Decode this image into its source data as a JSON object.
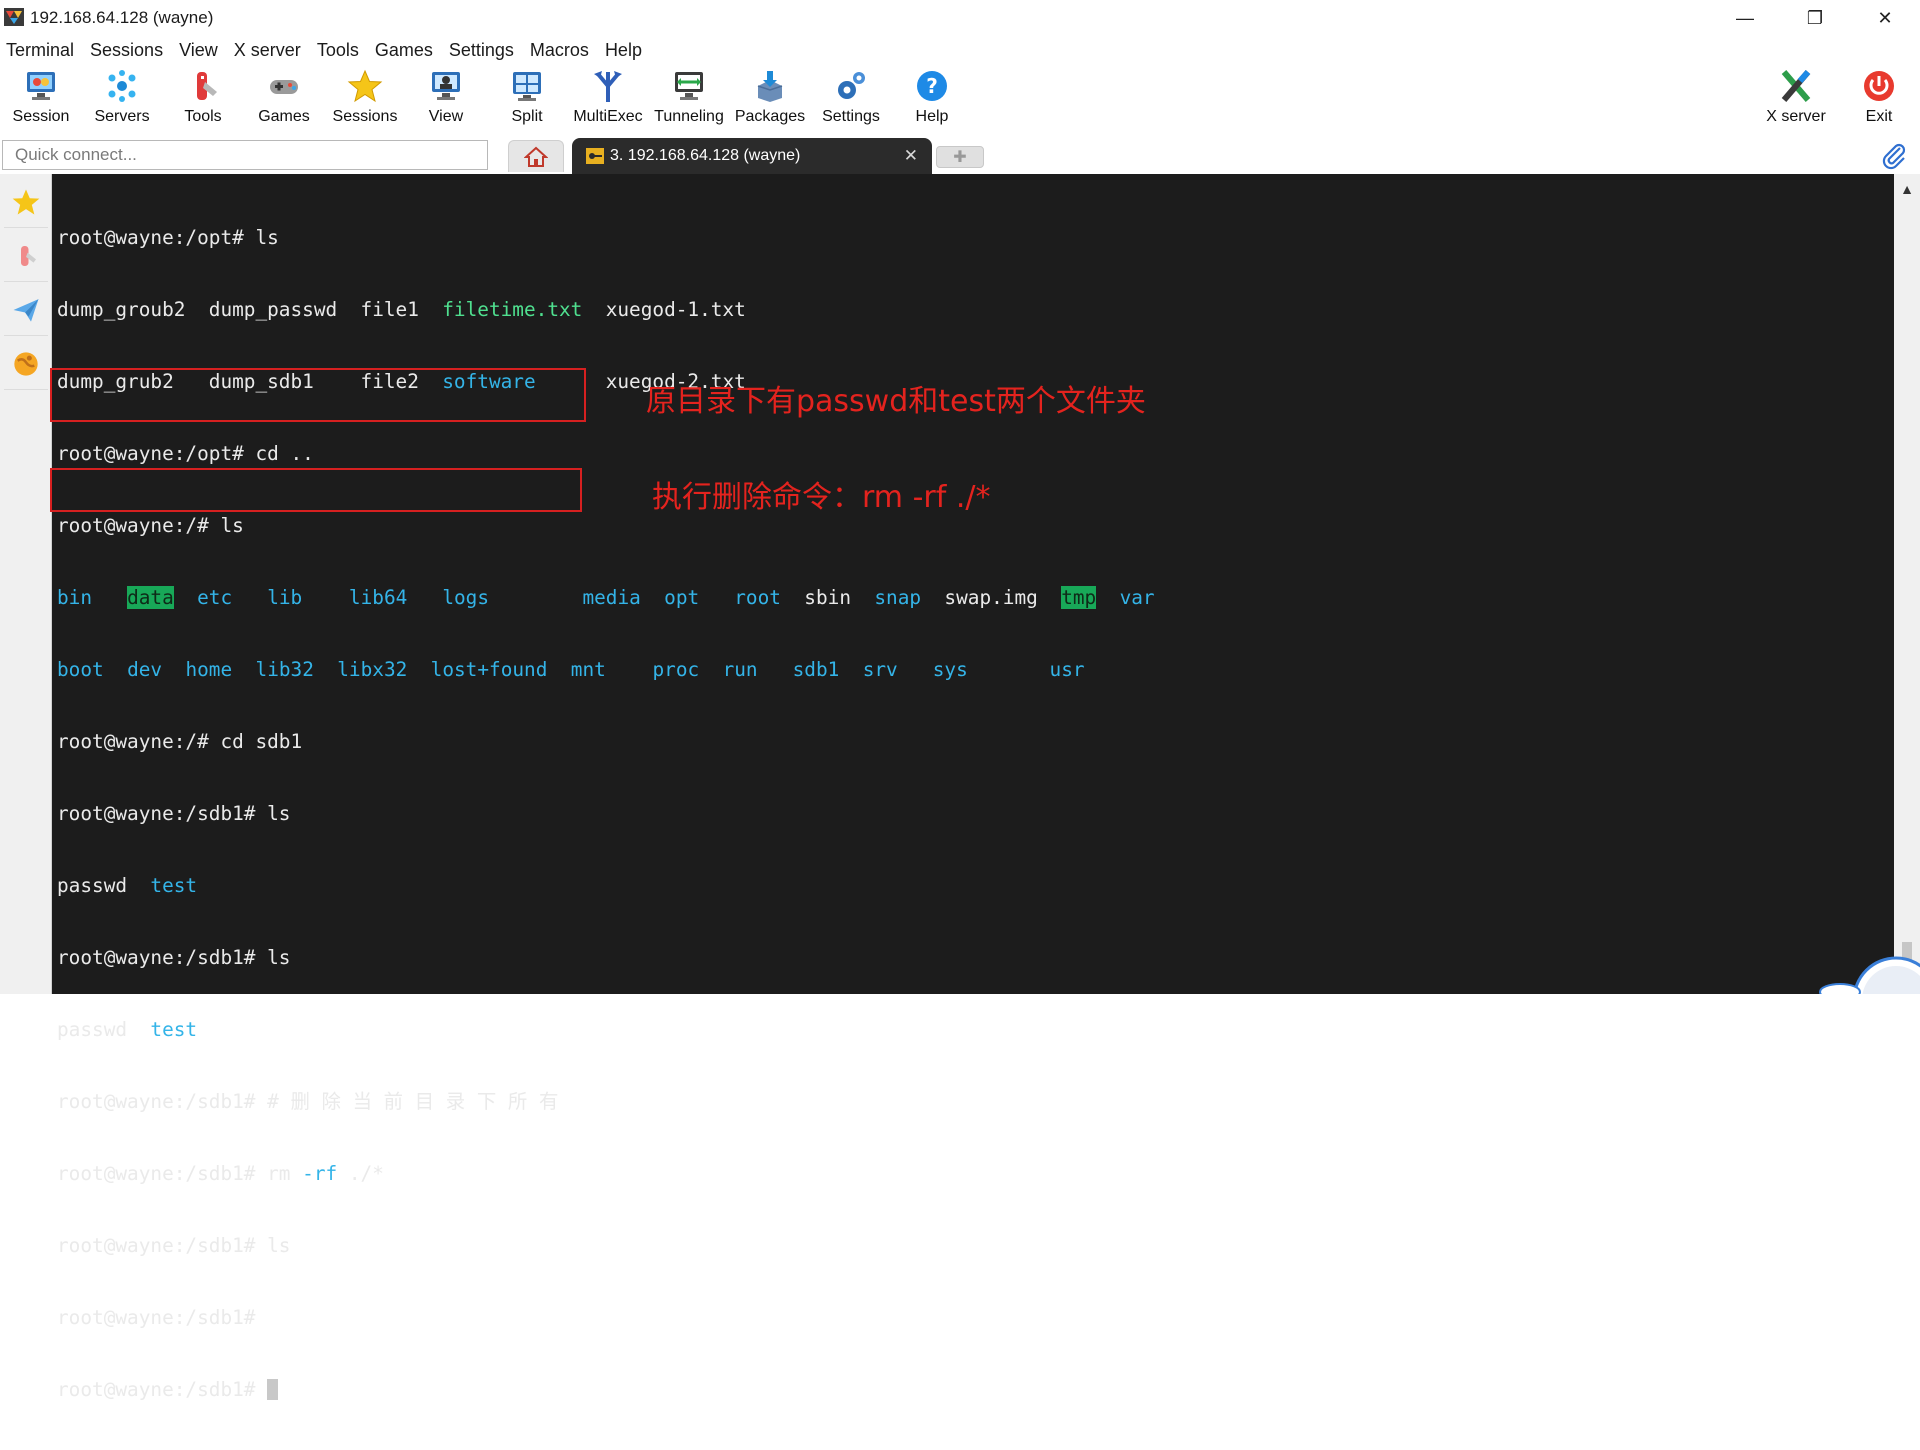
{
  "window": {
    "title": "192.168.64.128 (wayne)",
    "minimize_symbol": "—",
    "restore_symbol": "❐",
    "close_symbol": "✕"
  },
  "menu": [
    "Terminal",
    "Sessions",
    "View",
    "X server",
    "Tools",
    "Games",
    "Settings",
    "Macros",
    "Help"
  ],
  "toolbar": {
    "session": "Session",
    "servers": "Servers",
    "tools": "Tools",
    "games": "Games",
    "sessions": "Sessions",
    "view": "View",
    "split": "Split",
    "multiexec": "MultiExec",
    "tunneling": "Tunneling",
    "packages": "Packages",
    "settings": "Settings",
    "help": "Help",
    "xserver": "X server",
    "exit": "Exit"
  },
  "tabs": {
    "quick_connect_placeholder": "Quick connect...",
    "active_tab_label": "3. 192.168.64.128 (wayne)",
    "close_symbol": "✕",
    "new_tab_symbol": "✚"
  },
  "terminal": {
    "l1": "root@wayne:/opt# ls",
    "l2": {
      "a": "dump_groub2  dump_passwd  file1  ",
      "b": "filetime.txt",
      "c": "  xuegod-1.txt"
    },
    "l3": {
      "a": "dump_grub2   dump_sdb1    file2  ",
      "b": "software",
      "c": "      xuegod-2.txt"
    },
    "l4": "root@wayne:/opt# cd ..",
    "l5": "root@wayne:/# ls",
    "l6": {
      "bin": "bin",
      "data": "data",
      "etc": "etc",
      "lib": "lib",
      "lib64": "lib64",
      "logs": "logs",
      "media": "media",
      "opt": "opt",
      "root": "root",
      "sbin": "sbin",
      "snap": "snap",
      "swap": "swap.img",
      "tmp": "tmp",
      "var": "var"
    },
    "l7": {
      "boot": "boot",
      "dev": "dev",
      "home": "home",
      "lib32": "lib32",
      "libx32": "libx32",
      "lostfound": "lost+found",
      "mnt": "mnt",
      "proc": "proc",
      "run": "run",
      "sdb1": "sdb1",
      "srv": "srv",
      "sys": "sys",
      "usr": "usr"
    },
    "l8": "root@wayne:/# cd sdb1",
    "l9": "root@wayne:/sdb1# ls",
    "l10": {
      "a": "passwd  ",
      "b": "test"
    },
    "l11": "root@wayne:/sdb1# ls",
    "l12": {
      "a": "passwd  ",
      "b": "test"
    },
    "l13": "root@wayne:/sdb1# # 删 除 当 前 目 录 下 所 有",
    "l14": {
      "a": "root@wayne:/sdb1# rm ",
      "b": "-rf",
      "c": " ./*"
    },
    "l15": "root@wayne:/sdb1# ls",
    "l16": "root@wayne:/sdb1#",
    "l17": "root@wayne:/sdb1# "
  },
  "annotations": {
    "a1": "原目录下有passwd和test两个文件夹",
    "a2": "执行删除命令：rm -rf ./*"
  },
  "colors": {
    "terminal_bg": "#1c1c1c",
    "dir_blue": "#34b4e8",
    "file_green": "#4fe08f",
    "highlight_bg": "#18a858",
    "annotation_red": "#e4231e"
  }
}
